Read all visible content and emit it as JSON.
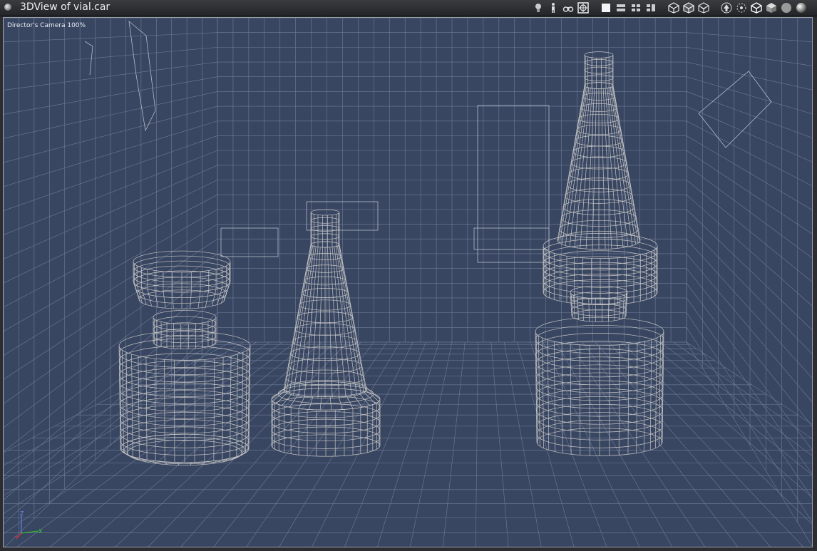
{
  "window": {
    "title": "3DView of vial.car"
  },
  "viewport": {
    "camera_label": "Director's Camera 100%"
  },
  "toolbar": {
    "icons": [
      "light-bulb-icon",
      "person-figure-icon",
      "binoculars-icon",
      "target-frame-icon",
      "single-view-icon",
      "two-views-icon",
      "four-views-icon",
      "three-views-icon",
      "wire-cube-icon",
      "shaded-wire-cube-icon",
      "hidden-line-cube-icon",
      "up-arrow-icon",
      "rotate-node-icon",
      "box-outline-icon",
      "solid-cube-icon",
      "gray-sphere-icon",
      "shaded-sphere-icon"
    ]
  },
  "axis": {
    "z": "Z",
    "x": "X",
    "y": "Y",
    "z_color": "#6a8cff",
    "x_color": "#30d020",
    "y_color": "#ff3030"
  },
  "colors": {
    "viewport_bg": "#394661",
    "grid": "#6f7c98",
    "wire": "#c4c4c4"
  }
}
